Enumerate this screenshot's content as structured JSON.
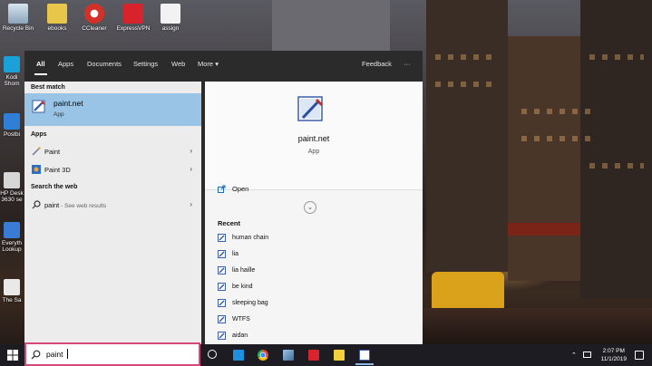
{
  "desktop": {
    "icons": [
      {
        "label": "Recycle Bin"
      },
      {
        "label": "ebooks"
      },
      {
        "label": "CCleaner"
      },
      {
        "label": "ExpressVPN"
      },
      {
        "label": "assign"
      }
    ],
    "left_column_partial": [
      "Kodi",
      "Shom",
      "Postbi",
      "HP Desk",
      "3630 se",
      "Everyth",
      "Lookup",
      "The Sa"
    ]
  },
  "start_menu": {
    "tabs": [
      "All",
      "Apps",
      "Documents",
      "Settings",
      "Web",
      "More"
    ],
    "more_caret": "▾",
    "feedback_label": "Feedback",
    "ellipsis": "···",
    "best_match_heading": "Best match",
    "best_match": {
      "title": "paint.net",
      "subtitle": "App"
    },
    "apps_heading": "Apps",
    "apps": [
      {
        "label": "Paint"
      },
      {
        "label": "Paint 3D"
      }
    ],
    "web_heading": "Search the web",
    "web_result": {
      "query": "paint",
      "suffix": " - See web results"
    },
    "preview": {
      "title": "paint.net",
      "subtitle": "App",
      "open_label": "Open",
      "recent_heading": "Recent",
      "recent": [
        "human chain",
        "lia",
        "lia haille",
        "be kind",
        "sleeping bag",
        "WTFS",
        "aidan"
      ]
    }
  },
  "taskbar": {
    "search_value": "paint",
    "time": "2:07 PM",
    "date": "11/1/2019"
  }
}
